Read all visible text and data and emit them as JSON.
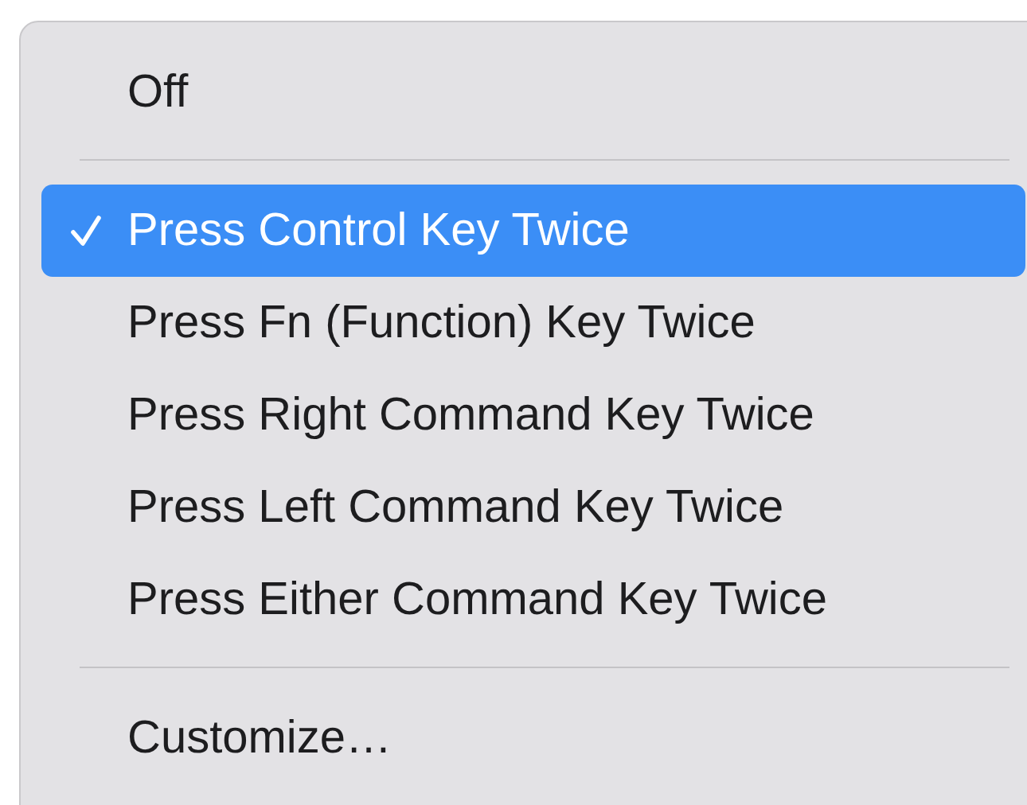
{
  "menu": {
    "items": [
      {
        "kind": "item",
        "label": "Off",
        "checked": false,
        "selected": false
      },
      {
        "kind": "separator"
      },
      {
        "kind": "item",
        "label": "Press Control Key Twice",
        "checked": true,
        "selected": true
      },
      {
        "kind": "item",
        "label": "Press Fn (Function) Key Twice",
        "checked": false,
        "selected": false
      },
      {
        "kind": "item",
        "label": "Press Right Command Key Twice",
        "checked": false,
        "selected": false
      },
      {
        "kind": "item",
        "label": "Press Left Command Key Twice",
        "checked": false,
        "selected": false
      },
      {
        "kind": "item",
        "label": "Press Either Command Key Twice",
        "checked": false,
        "selected": false
      },
      {
        "kind": "separator"
      },
      {
        "kind": "item",
        "label": "Customize…",
        "checked": false,
        "selected": false
      }
    ]
  }
}
